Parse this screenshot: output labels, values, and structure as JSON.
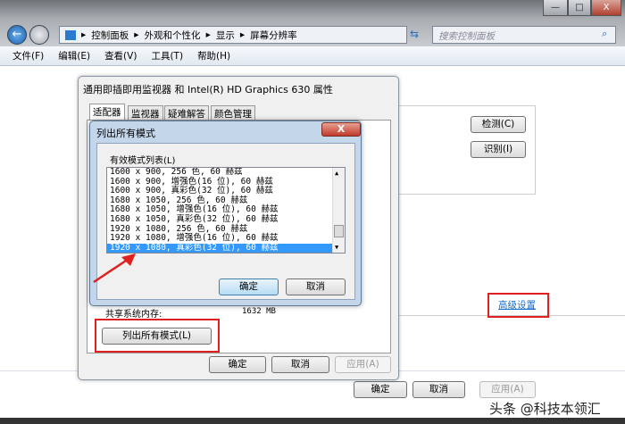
{
  "window": {
    "minimize": "—",
    "maximize": "□",
    "close": "X"
  },
  "nav": {
    "breadcrumb": [
      "控制面板",
      "外观和个性化",
      "显示",
      "屏幕分辨率"
    ],
    "search_placeholder": "搜索控制面板"
  },
  "menu": [
    "文件(F)",
    "编辑(E)",
    "查看(V)",
    "工具(T)",
    "帮助(H)"
  ],
  "main": {
    "detect": "检测(C)",
    "identify": "识别(I)",
    "advanced": "高级设置",
    "ok": "确定",
    "cancel": "取消",
    "apply": "应用(A)"
  },
  "props": {
    "title": "通用即插即用监视器 和 Intel(R) HD Graphics 630 属性",
    "tabs": [
      "适配器",
      "监视器",
      "疑难解答",
      "颜色管理"
    ],
    "shared_mem_label": "共享系统内存:",
    "shared_mem_value": "1632 MB",
    "list_all": "列出所有模式(L)",
    "ok": "确定",
    "cancel": "取消",
    "apply": "应用(A)"
  },
  "modes": {
    "title": "列出所有模式",
    "close": "X",
    "group_label": "有效模式列表(L)",
    "items": [
      "1600 x 900, 256 色, 60 赫兹",
      "1600 x 900, 增强色(16 位), 60 赫兹",
      "1600 x 900, 真彩色(32 位), 60 赫兹",
      "1680 x 1050, 256 色, 60 赫兹",
      "1680 x 1050, 增强色(16 位), 60 赫兹",
      "1680 x 1050, 真彩色(32 位), 60 赫兹",
      "1920 x 1080, 256 色, 60 赫兹",
      "1920 x 1080, 增强色(16 位), 60 赫兹",
      "1920 x 1080, 真彩色(32 位), 60 赫兹"
    ],
    "selected_index": 8,
    "ok": "确定",
    "cancel": "取消"
  },
  "watermark": "头条 @科技本领汇",
  "colors": {
    "highlight": "#e02020",
    "selection": "#3399ff",
    "link": "#1a6fd0"
  }
}
